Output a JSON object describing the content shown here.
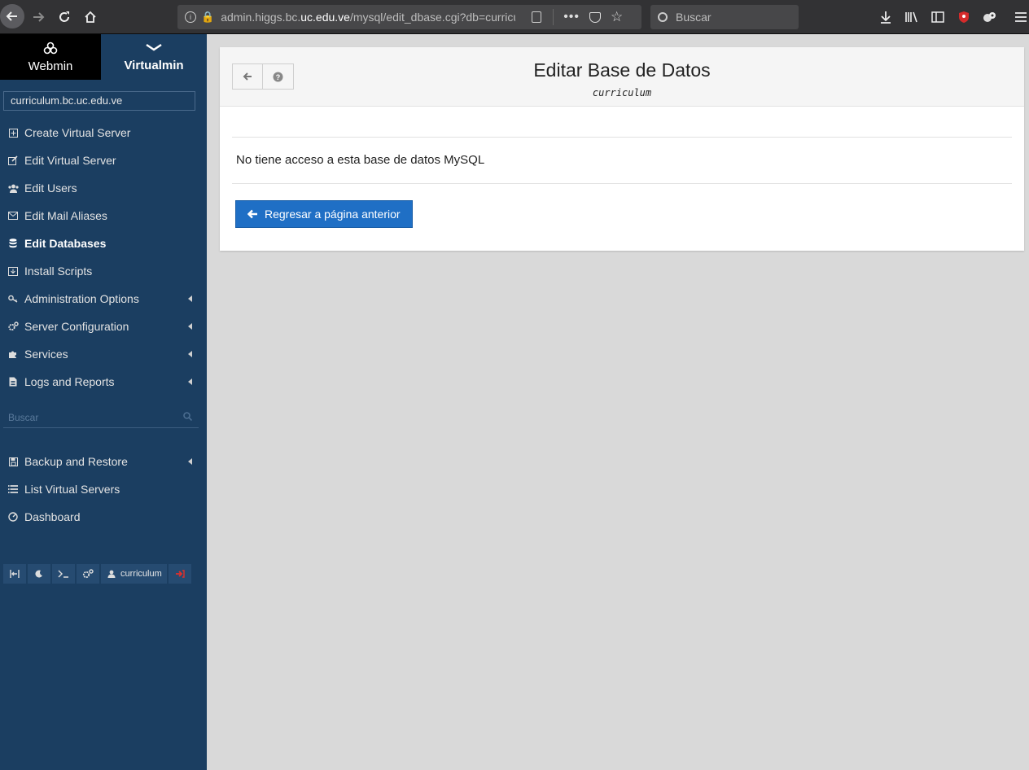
{
  "browser": {
    "url_prefix": "admin.higgs.bc.",
    "url_host": "uc.edu.ve",
    "url_path": "/mysql/edit_dbase.cgi?db=curricul",
    "search_placeholder": "Buscar"
  },
  "sidebar": {
    "tab_webmin": "Webmin",
    "tab_virtualmin": "Virtualmin",
    "domain_select": "curriculum.bc.uc.edu.ve",
    "items": [
      {
        "label": "Create Virtual Server",
        "icon": "plus-square-icon"
      },
      {
        "label": "Edit Virtual Server",
        "icon": "edit-icon"
      },
      {
        "label": "Edit Users",
        "icon": "users-icon"
      },
      {
        "label": "Edit Mail Aliases",
        "icon": "envelope-icon"
      },
      {
        "label": "Edit Databases",
        "icon": "database-icon"
      },
      {
        "label": "Install Scripts",
        "icon": "download-icon"
      },
      {
        "label": "Administration Options",
        "icon": "key-icon"
      },
      {
        "label": "Server Configuration",
        "icon": "cogs-icon"
      },
      {
        "label": "Services",
        "icon": "puzzle-icon"
      },
      {
        "label": "Logs and Reports",
        "icon": "file-icon"
      }
    ],
    "search_placeholder": "Buscar",
    "items2": [
      {
        "label": "Backup and Restore",
        "icon": "save-icon"
      },
      {
        "label": "List Virtual Servers",
        "icon": "list-icon"
      },
      {
        "label": "Dashboard",
        "icon": "dashboard-icon"
      }
    ],
    "user": "curriculum"
  },
  "content": {
    "title": "Editar Base de Datos",
    "subtitle": "curriculum",
    "message": "No tiene acceso a esta base de datos MySQL",
    "return_label": "Regresar a página anterior"
  }
}
